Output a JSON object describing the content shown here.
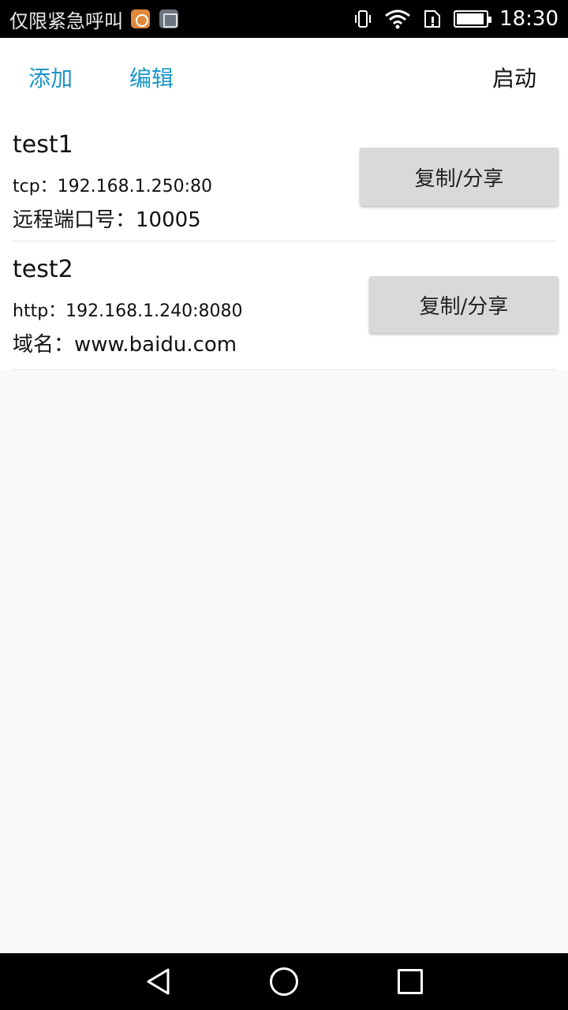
{
  "status_bar": {
    "carrier": "仅限紧急呼叫",
    "time": "18:30",
    "icons": [
      "uc-browser-icon",
      "gallery-icon",
      "vibrate-icon",
      "wifi-icon",
      "sim-alert-icon",
      "battery-icon"
    ],
    "battery_level": 0.95
  },
  "toolbar": {
    "add_label": "添加",
    "edit_label": "编辑",
    "start_label": "启动",
    "accent_color": "#1a96c8"
  },
  "items": [
    {
      "name": "test1",
      "line1": "tcp：192.168.1.250:80",
      "line2": "远程端口号：10005",
      "button": "复制/分享"
    },
    {
      "name": "test2",
      "line1": "http：192.168.1.240:8080",
      "line2": "域名：www.baidu.com",
      "button": "复制/分享"
    }
  ],
  "nav_bar": {
    "icons": [
      "back-icon",
      "home-icon",
      "recents-icon"
    ]
  }
}
